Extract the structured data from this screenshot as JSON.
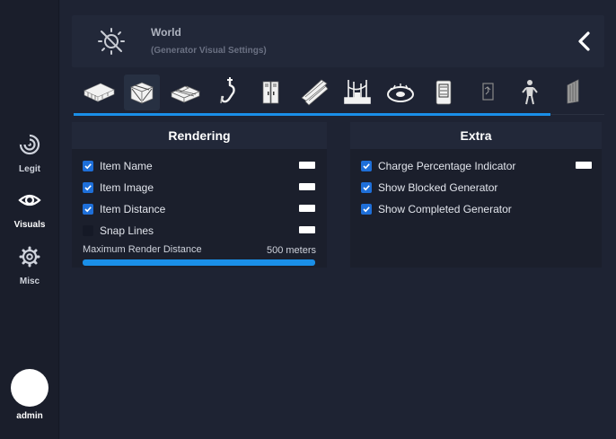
{
  "sidebar": {
    "items": [
      {
        "label": "Legit",
        "icon": "target-icon"
      },
      {
        "label": "Visuals",
        "icon": "eye-icon"
      },
      {
        "label": "Misc",
        "icon": "gear-icon"
      }
    ],
    "user": {
      "name": "admin"
    }
  },
  "header": {
    "title": "World",
    "subtitle": "(Generator Visual Settings)",
    "icon": "hidden-sun-icon",
    "back_icon": "chevron-left-icon"
  },
  "tabs": [
    {
      "icon": "pallet-icon"
    },
    {
      "icon": "crate-icon",
      "active": true
    },
    {
      "icon": "toolbox-icon"
    },
    {
      "icon": "hook-icon"
    },
    {
      "icon": "locker-icon"
    },
    {
      "icon": "planks-icon"
    },
    {
      "icon": "generator-icon"
    },
    {
      "icon": "trap-icon"
    },
    {
      "icon": "totem-icon"
    },
    {
      "icon": "exit-door-icon"
    },
    {
      "icon": "survivor-icon"
    },
    {
      "icon": "hatch-icon"
    }
  ],
  "rendering": {
    "title": "Rendering",
    "options": [
      {
        "label": "Item Name",
        "checked": true,
        "color": "#ffffff"
      },
      {
        "label": "Item Image",
        "checked": true,
        "color": "#ffffff"
      },
      {
        "label": "Item Distance",
        "checked": true,
        "color": "#ffffff"
      },
      {
        "label": "Snap Lines",
        "checked": false,
        "color": "#ffffff"
      }
    ],
    "slider": {
      "label": "Maximum Render Distance",
      "value": "500 meters",
      "fill": 1.0
    }
  },
  "extra": {
    "title": "Extra",
    "options": [
      {
        "label": "Charge Percentage Indicator",
        "checked": true,
        "color": "#ffffff"
      },
      {
        "label": "Show Blocked Generator",
        "checked": true
      },
      {
        "label": "Show Completed Generator",
        "checked": true
      }
    ]
  },
  "colors": {
    "accent": "#1a8fe8",
    "checkbox": "#1e6fd9"
  }
}
